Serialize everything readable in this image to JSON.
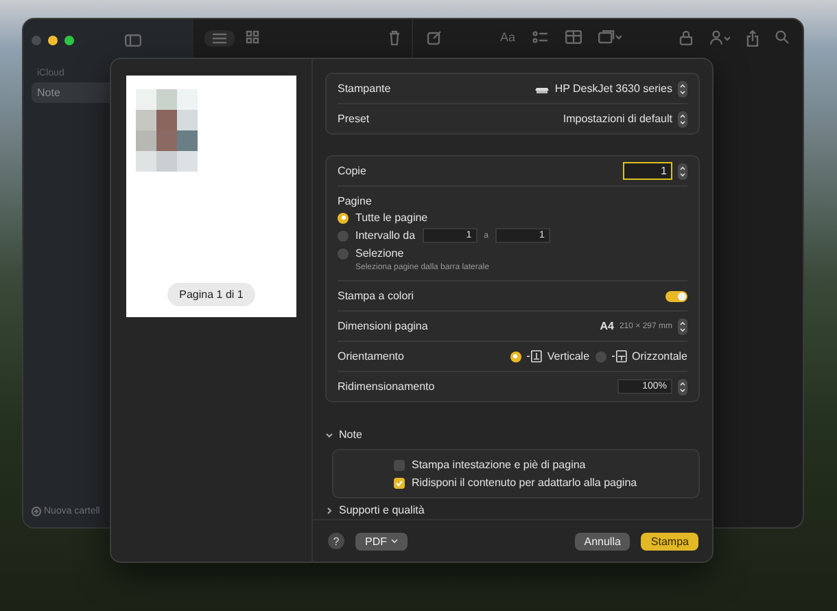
{
  "notes_window": {
    "format_button": "Aa",
    "sidebar": {
      "section": "iCloud",
      "items": [
        {
          "label": "Note",
          "selected": true
        }
      ],
      "new_folder": "Nuova cartell"
    }
  },
  "print_dialog": {
    "preview": {
      "page_indicator": "Pagina 1 di 1"
    },
    "printer": {
      "label": "Stampante",
      "value": "HP DeskJet 3630 series"
    },
    "preset": {
      "label": "Preset",
      "value": "Impostazioni di default"
    },
    "copies": {
      "label": "Copie",
      "value": "1"
    },
    "pages": {
      "label": "Pagine",
      "options": [
        {
          "kind": "plain",
          "label": "Tutte le pagine",
          "selected": true
        },
        {
          "kind": "range",
          "label": "Intervallo da",
          "selected": false,
          "from": "1",
          "to_label": "a",
          "to": "1"
        },
        {
          "kind": "hint",
          "label": "Selezione",
          "selected": false,
          "hint": "Seleziona pagine dalla barra laterale"
        }
      ]
    },
    "color": {
      "label": "Stampa a colori",
      "on": true
    },
    "paper_size": {
      "label": "Dimensioni pagina",
      "value": "A4",
      "detail": "210 × 297 mm"
    },
    "orientation": {
      "label": "Orientamento",
      "options": [
        {
          "label": "Verticale",
          "selected": true
        },
        {
          "label": "Orizzontale",
          "selected": false
        }
      ]
    },
    "scaling": {
      "label": "Ridimensionamento",
      "value": "100%"
    },
    "notes_section": {
      "title": "Note",
      "expanded": true,
      "options": [
        {
          "label": "Stampa intestazione e piè di pagina",
          "checked": false
        },
        {
          "label": "Ridisponi il contenuto per adattarlo alla pagina",
          "checked": true
        }
      ]
    },
    "next_section": {
      "title": "Supporti e qualità",
      "expanded": false
    },
    "footer": {
      "help": "?",
      "pdf": "PDF",
      "cancel": "Annulla",
      "print": "Stampa"
    }
  }
}
